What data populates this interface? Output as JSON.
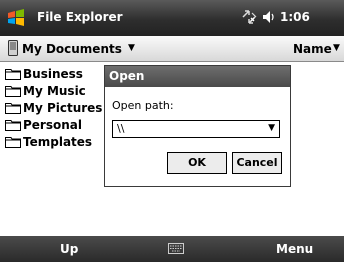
{
  "titlebar": {
    "app_title": "File Explorer",
    "time": "1:06",
    "icons": [
      "windows-logo-icon",
      "connectivity-icon",
      "volume-icon"
    ]
  },
  "folderbar": {
    "folder": "My Documents",
    "sort": "Name"
  },
  "files": [
    {
      "name": "Business",
      "icon": "folder-icon"
    },
    {
      "name": "My Music",
      "icon": "folder-icon"
    },
    {
      "name": "My Pictures",
      "icon": "folder-icon"
    },
    {
      "name": "Personal",
      "icon": "folder-icon"
    },
    {
      "name": "Templates",
      "icon": "folder-icon"
    }
  ],
  "dialog": {
    "title": "Open",
    "label": "Open path:",
    "path_value": "\\\\",
    "ok_label": "OK",
    "cancel_label": "Cancel"
  },
  "softkeys": {
    "left": "Up",
    "right": "Menu",
    "center_icon": "keyboard-icon"
  },
  "colors": {
    "titlebar": "#2e2e2e",
    "dialog_title": "#5a5a5a",
    "folder_icon": "#c9a64a"
  }
}
